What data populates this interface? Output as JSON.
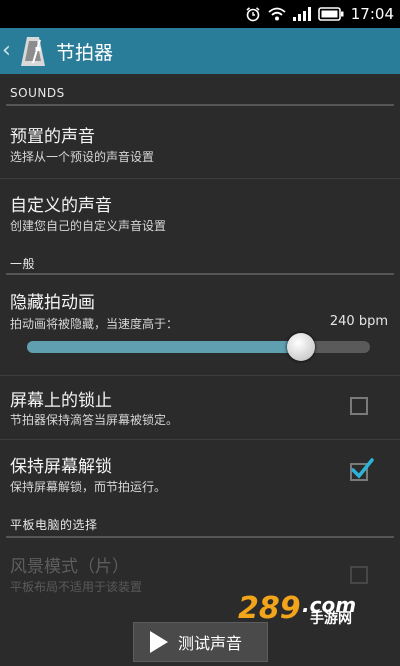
{
  "status": {
    "time": "17:04"
  },
  "actionbar": {
    "title": "节拍器"
  },
  "sections": {
    "sounds": "SOUNDS",
    "general": "一般",
    "tablet": "平板电脑的选择"
  },
  "prefs": {
    "preset": {
      "title": "预置的声音",
      "summary": "选择从一个预设的声音设置"
    },
    "custom": {
      "title": "自定义的声音",
      "summary": "创建您自己的自定义声音设置"
    },
    "hide_anim": {
      "title": "隐藏拍动画",
      "summary": "拍动画将被隐藏，当速度高于：",
      "value_label": "240 bpm",
      "slider_fraction": 0.8
    },
    "screen_lock": {
      "title": "屏幕上的锁止",
      "summary": "节拍器保持滴答当屏幕被锁定。",
      "checked": false
    },
    "keep_unlocked": {
      "title": "保持屏幕解锁",
      "summary": "保持屏幕解锁，而节拍运行。",
      "checked": true
    },
    "landscape": {
      "title": "风景模式（片）",
      "summary": "平板布局不适用于该装置",
      "checked": false,
      "disabled": true
    }
  },
  "test_button": {
    "label": "测试声音"
  },
  "watermark": {
    "logo": "289.com",
    "sub": "手游网"
  },
  "colors": {
    "accent": "#2a7d99",
    "slider_fill": "#5f9fb0",
    "check": "#2db3d6"
  }
}
